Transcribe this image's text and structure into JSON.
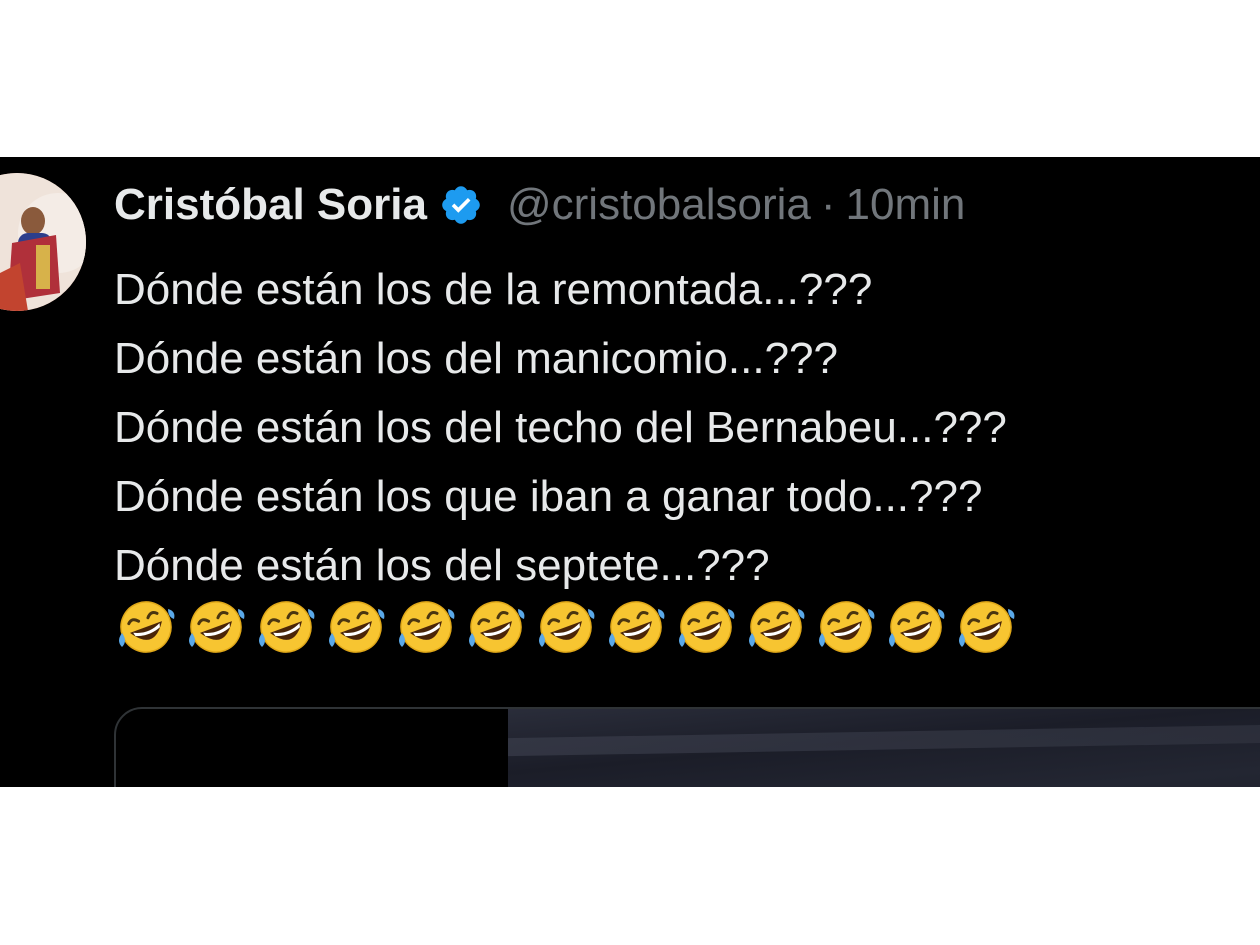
{
  "tweet": {
    "author_name": "Cristóbal Soria",
    "handle": "@cristobalsoria",
    "separator": "·",
    "time": "10min",
    "lines": [
      "Dónde están los de la remontada...???",
      "Dónde están los del manicomio...???",
      "Dónde están los del techo del Bernabeu...???",
      "Dónde están los que iban a ganar todo...???",
      "Dónde están los del septete...???"
    ],
    "emoji_name": "rolling-on-the-floor-laughing-icon",
    "emoji_count": 13
  },
  "colors": {
    "background": "#000000",
    "text_primary": "#e7e9ea",
    "text_secondary": "#71767b",
    "verified": "#1d9bf0",
    "border": "#2f3336"
  }
}
